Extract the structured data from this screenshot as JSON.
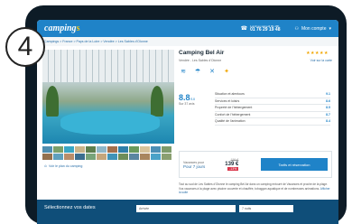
{
  "step": "4",
  "header": {
    "logo_text": "camping",
    "logo_dot": "s",
    "phone_caption": "Lundi au samedi 9h-18h",
    "phone_number": "01 76 29 19 48",
    "account_label": "Mon compte"
  },
  "breadcrumb": "Campings  >  France  >  Pays de la Loire  >  Vendée  >  Les Sables d'Olonne",
  "campsite": {
    "name": "Camping Bel Air",
    "stars": "★★★★★",
    "address": "Vendée - Les Sables d'Olonne",
    "see_map": "Voir sur la carte",
    "score": "8.8",
    "score_out": "/10",
    "reviews": "Sur 37 avis",
    "ratings": [
      {
        "label": "Situation et alentours",
        "value": "9.1"
      },
      {
        "label": "Services et loisirs",
        "value": "8.6"
      },
      {
        "label": "Propreté de l'hébergement",
        "value": "8.5"
      },
      {
        "label": "Confort de l'hébergement",
        "value": "8.7"
      },
      {
        "label": "Qualité de l'animation",
        "value": "8.4"
      }
    ],
    "book": {
      "dates_caption": "Vacances pour",
      "dates": "Pour 7 jours",
      "old_price": "159 €",
      "price": "139 €",
      "discount": "-13%",
      "button": "Tarifs et réservation"
    },
    "description": "Tout au sud de Les Sables d'Olonne le camping Bel Air dans un camping entouré de Vacances et proche de la plage. Vos vacances à la plage avec piscine couverte et chauffée, toboggan aquatique et de nombreuses animations.",
    "more": "Afficher la suite",
    "map_link": "Voir le plan du camping"
  },
  "bottom": {
    "title": "Sélectionnez vos dates",
    "arrival": "Arrivée",
    "nights": "7 nuits"
  },
  "colors": {
    "brand": "#1f83c8",
    "dark": "#0f4e79",
    "accent": "#f0c419",
    "discount": "#d9354a"
  }
}
